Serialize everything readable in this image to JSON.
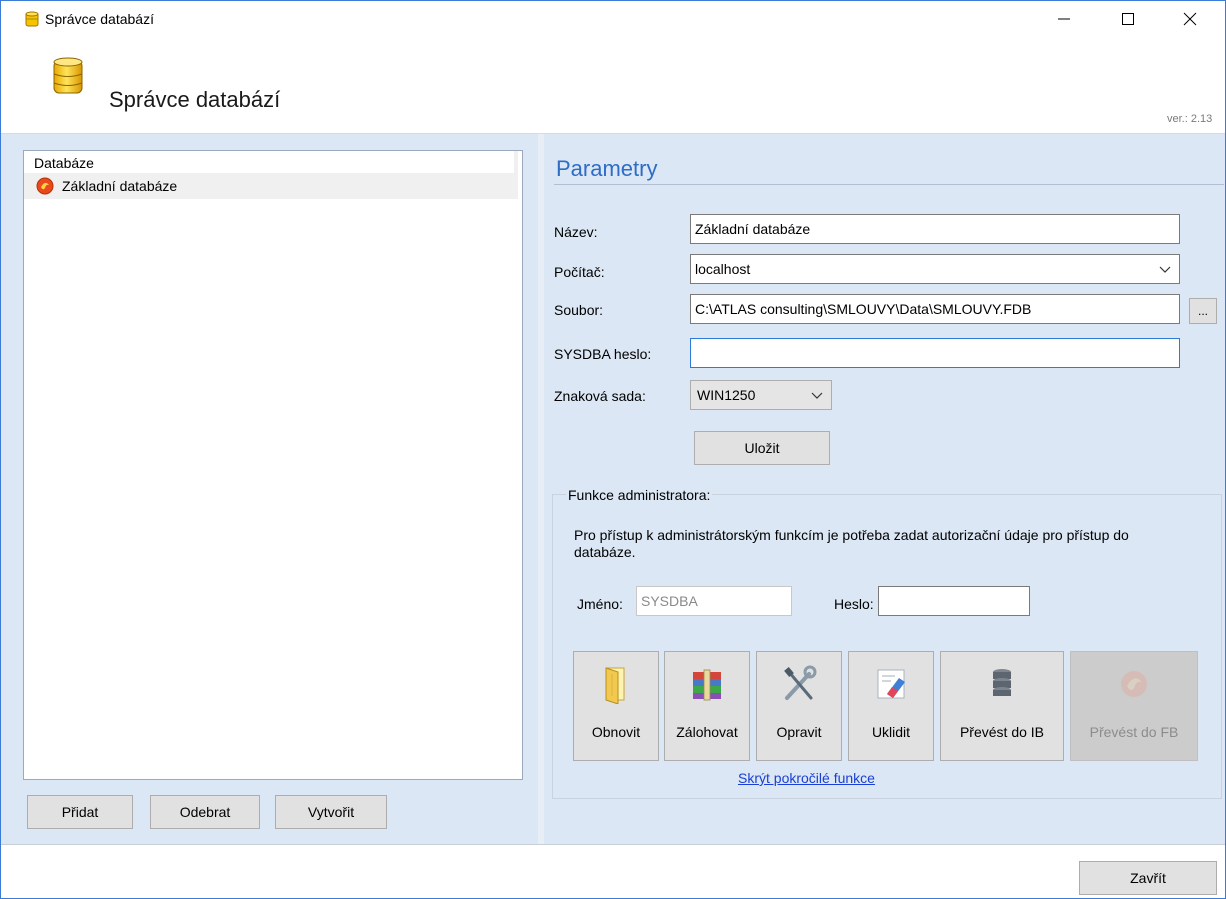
{
  "window": {
    "title": "Správce databází",
    "minimize_glyph": "minimize-icon",
    "maximize_glyph": "maximize-icon",
    "close_glyph": "close-icon"
  },
  "header": {
    "title": "Správce databází",
    "version": "ver.: 2.13",
    "icon": "database-icon"
  },
  "left": {
    "list_header": "Databáze",
    "items": [
      {
        "label": "Základní databáze",
        "icon": "firebird-icon"
      }
    ],
    "buttons": {
      "add": "Přidat",
      "remove": "Odebrat",
      "create": "Vytvořit"
    }
  },
  "params": {
    "title": "Parametry",
    "name_label": "Název:",
    "name_value": "Základní databáze",
    "computer_label": "Počítač:",
    "computer_value": "localhost",
    "file_label": "Soubor:",
    "file_value": "C:\\ATLAS consulting\\SMLOUVY\\Data\\SMLOUVY.FDB",
    "browse_label": "...",
    "sysdba_label": "SYSDBA heslo:",
    "sysdba_value": "",
    "charset_label": "Znaková sada:",
    "charset_value": "WIN1250",
    "save_label": "Uložit"
  },
  "admin": {
    "group_label": "Funkce administratora:",
    "info_text": "Pro přístup k administrátorským funkcím je potřeba zadat autorizační údaje pro přístup do databáze.",
    "user_label": "Jméno:",
    "user_value": "SYSDBA",
    "password_label": "Heslo:",
    "password_value": "",
    "tools": [
      {
        "label": "Obnovit",
        "icon": "folder-icon",
        "enabled": true
      },
      {
        "label": "Zálohovat",
        "icon": "archive-icon",
        "enabled": true
      },
      {
        "label": "Opravit",
        "icon": "tools-icon",
        "enabled": true
      },
      {
        "label": "Uklidit",
        "icon": "eraser-icon",
        "enabled": true
      },
      {
        "label": "Převést do IB",
        "icon": "database-stack-icon",
        "enabled": true
      },
      {
        "label": "Převést do FB",
        "icon": "firebird-icon",
        "enabled": false
      }
    ],
    "hide_link": "Skrýt pokročilé funkce"
  },
  "footer": {
    "close_label": "Zavřít"
  },
  "colors": {
    "accent": "#2e6cc6",
    "panel": "#dbe7f4",
    "link": "#1a3fd6"
  }
}
